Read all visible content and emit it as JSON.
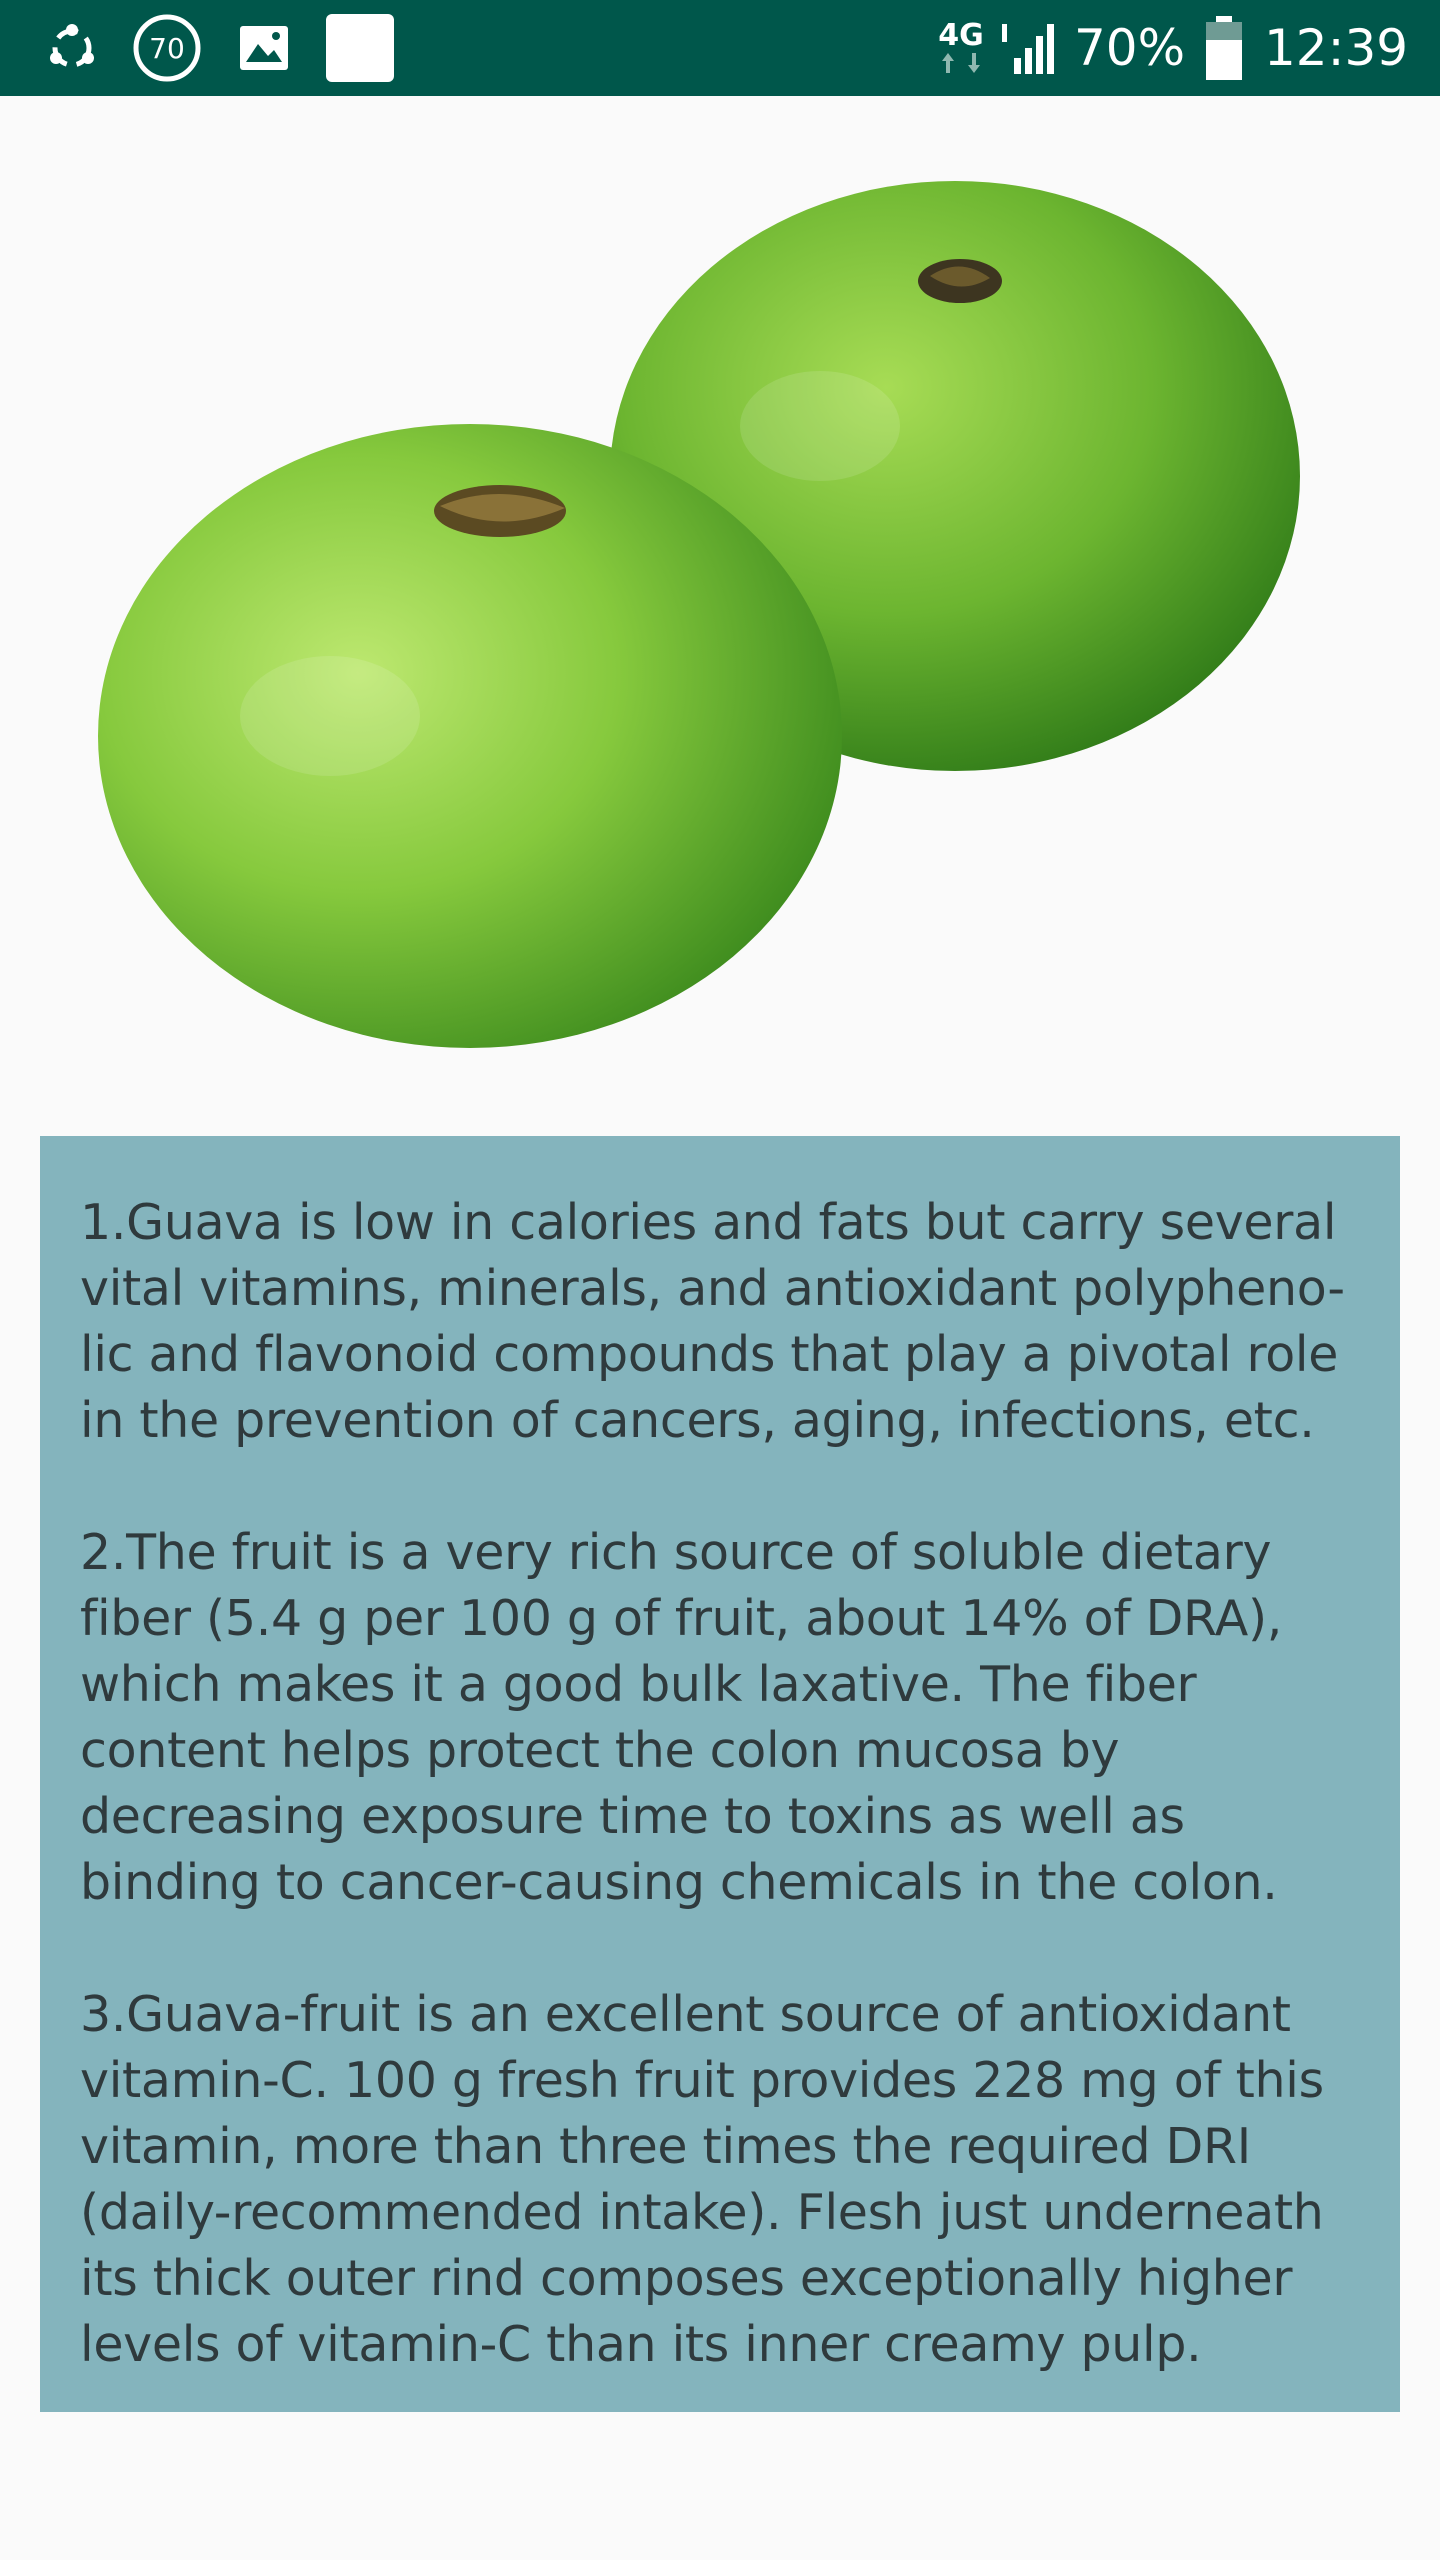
{
  "status_bar": {
    "notification_icons": [
      "share-sync-icon",
      "badge-counter-icon",
      "gallery-icon",
      "blank-app-icon"
    ],
    "badge_count": "70",
    "network": "4G",
    "signal_icon": "signal-icon",
    "battery_percent": "70%",
    "battery_icon": "battery-icon",
    "time": "12:39",
    "background_color": "#00574b"
  },
  "hero_image": {
    "icon": "guava-fruit-image",
    "colors": {
      "fruit": "#7dc43a",
      "fruit_dark": "#3f8a1e",
      "background": "#fafafa"
    }
  },
  "facts": [
    "1.Guava is low in calories and fats but carry several vital vitamins, minerals, and antioxidant polypheno-lic and flavonoid compounds that play a pivotal role in the prevention of cancers, aging, infections, etc.",
    "2.The fruit is a very rich source of soluble dietary fiber (5.4 g per 100 g of fruit, about 14% of DRA), which makes it a good bulk laxative. The fiber content helps protect the colon mucosa by decreasing exposure time to toxins as well as binding to cancer-causing chemicals in the colon.",
    "3.Guava-fruit is an excellent source of antioxidant vitamin-C. 100 g fresh fruit provides 228 mg of this vitamin, more than three times the required DRI (daily-recommended intake). Flesh just underneath its thick outer rind composes exceptionally higher levels of vitamin-C than its inner creamy pulp."
  ],
  "card_color": "#84b4bd"
}
